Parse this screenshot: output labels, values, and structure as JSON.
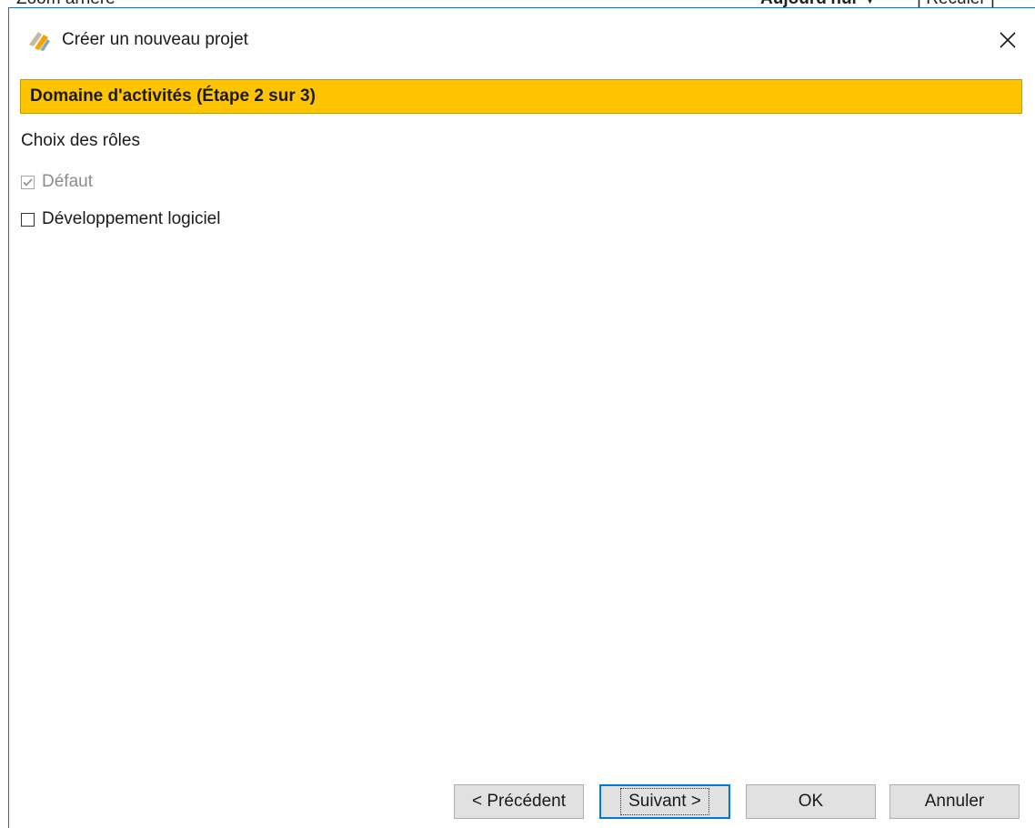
{
  "background": {
    "left_text": "Zoom arrière",
    "right_text": "Aujourd'hui ▼",
    "right_text2": "| Reculer |"
  },
  "dialog": {
    "title": "Créer un nouveau projet",
    "step_banner": "Domaine d'activités (Étape 2 sur 3)",
    "section_label": "Choix des rôles",
    "roles": [
      {
        "label": "Défaut",
        "checked": true,
        "disabled": true
      },
      {
        "label": "Développement logiciel",
        "checked": false,
        "disabled": false
      }
    ],
    "buttons": {
      "previous": "< Précédent",
      "next": "Suivant >",
      "ok": "OK",
      "cancel": "Annuler"
    }
  },
  "colors": {
    "banner": "#ffc400",
    "accent_border": "#1f6fbf",
    "default_button_border": "#0078d7"
  }
}
